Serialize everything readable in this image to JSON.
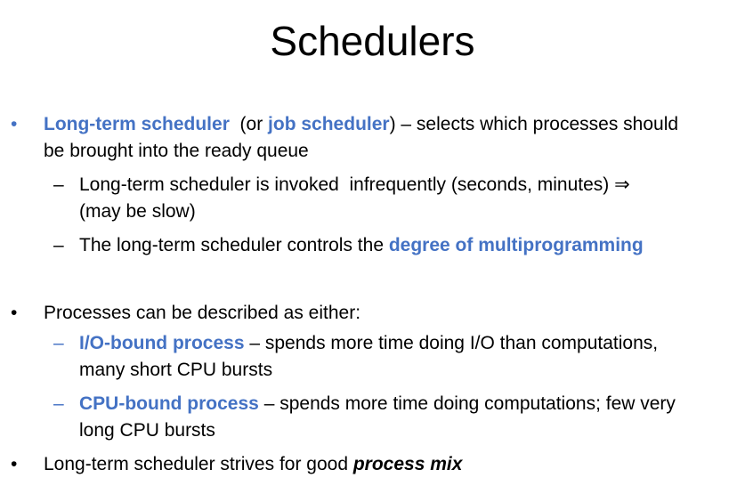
{
  "slide": {
    "title": "Schedulers",
    "bullet_symbol": "•",
    "dash_symbol": "–",
    "item1": {
      "term1": "Long-term scheduler",
      "text1": "  (or ",
      "term2": "job scheduler",
      "text2": ") – selects which processes should",
      "line2": "be brought into the ready queue"
    },
    "item1_sub1": {
      "line1": "Long-term scheduler is invoked  infrequently (seconds, minutes) ⇒",
      "line2": "(may be slow)"
    },
    "item1_sub2": {
      "text": "The long-term scheduler controls the ",
      "term": "degree of multiprogramming"
    },
    "item2": {
      "text": "Processes can be described as either:"
    },
    "item2_sub1": {
      "term": "I/O-bound process",
      "text": " – spends more time doing I/O than computations,",
      "line2": "many short CPU bursts"
    },
    "item2_sub2": {
      "term": "CPU-bound process",
      "text": " – spends more time doing computations; few very",
      "line2": "long CPU bursts"
    },
    "item3": {
      "text": "Long-term scheduler strives for good ",
      "term": "process mix"
    }
  },
  "colors": {
    "accent": "#4472c4",
    "text": "#000000",
    "background": "#ffffff"
  }
}
